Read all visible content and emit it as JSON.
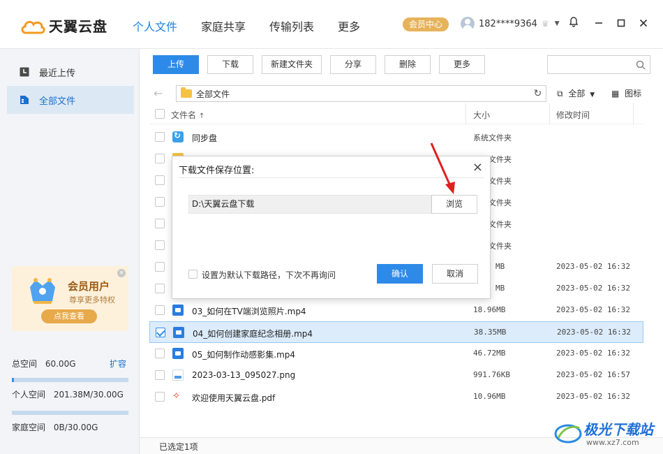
{
  "app": {
    "logo_text": "天翼云盘",
    "nav": [
      "个人文件",
      "家庭共享",
      "传输列表",
      "更多"
    ],
    "vip_label": "会员中心",
    "user_name": "182****9364"
  },
  "sidebar": {
    "items": [
      {
        "label": "最近上传",
        "icon": "clock-icon"
      },
      {
        "label": "全部文件",
        "icon": "file-icon"
      }
    ],
    "promo": {
      "title": "会员用户",
      "subtitle": "尊享更多特权",
      "button": "点我查看"
    },
    "storage": {
      "total_label": "总空间",
      "total_value": "60.00G",
      "expand_label": "扩容",
      "personal_label": "个人空间",
      "personal_value": "201.38M/30.00G",
      "personal_fill": 0.0066,
      "family_label": "家庭空间",
      "family_value": "0B/30.00G",
      "family_fill": 0
    }
  },
  "toolbar": {
    "upload": "上传",
    "download": "下载",
    "new_folder": "新建文件夹",
    "share": "分享",
    "delete": "删除",
    "more": "更多",
    "search_placeholder": ""
  },
  "pathbar": {
    "path": "全部文件",
    "filter": "全部",
    "view": "图标"
  },
  "list": {
    "headers": {
      "name": "文件名",
      "size": "大小",
      "date": "修改时间"
    },
    "rows": [
      {
        "name": "同步盘",
        "size": "系统文件夹",
        "date": "",
        "type": "sync",
        "checked": false
      },
      {
        "name": "",
        "size": "文件夹",
        "date": "",
        "type": "folder",
        "checked": false
      },
      {
        "name": "",
        "size": "文件夹",
        "date": "",
        "type": "folder",
        "checked": false
      },
      {
        "name": "",
        "size": "文件夹",
        "date": "",
        "type": "folder",
        "checked": false
      },
      {
        "name": "",
        "size": "文件夹",
        "date": "",
        "type": "folder",
        "checked": false
      },
      {
        "name": "",
        "size": "文件夹",
        "date": "",
        "type": "folder",
        "checked": false
      },
      {
        "name": "",
        "size": "MB",
        "date": "2023-05-02 16:32",
        "type": "video",
        "checked": false
      },
      {
        "name": "",
        "size": "MB",
        "date": "2023-05-02 16:32",
        "type": "video",
        "checked": false
      },
      {
        "name": "03_如何在TV端浏览照片.mp4",
        "size": "18.96MB",
        "date": "2023-05-02 16:32",
        "type": "video",
        "checked": false
      },
      {
        "name": "04_如何创建家庭纪念相册.mp4",
        "size": "38.35MB",
        "date": "2023-05-02 16:32",
        "type": "video",
        "checked": true
      },
      {
        "name": "05_如何制作动感影集.mp4",
        "size": "46.72MB",
        "date": "2023-05-02 16:32",
        "type": "video",
        "checked": false
      },
      {
        "name": "2023-03-13_095027.png",
        "size": "991.76KB",
        "date": "2023-05-02 16:57",
        "type": "img",
        "checked": false
      },
      {
        "name": "欢迎使用天翼云盘.pdf",
        "size": "10.96MB",
        "date": "2023-05-02 16:32",
        "type": "pdf",
        "checked": false
      }
    ]
  },
  "status": {
    "selected": "已选定1项"
  },
  "dialog": {
    "title": "下载文件保存位置:",
    "path": "D:\\天翼云盘下载",
    "browse": "浏览",
    "default_checkbox": "设置为默认下载路径，下次不再询问",
    "ok": "确认",
    "cancel": "取消"
  },
  "watermark": {
    "text": "极光下载站",
    "url": "www.xz7.com"
  },
  "colors": {
    "accent": "#2d8ae8",
    "vip": "#e6b35a",
    "arrow": "#e02020"
  }
}
